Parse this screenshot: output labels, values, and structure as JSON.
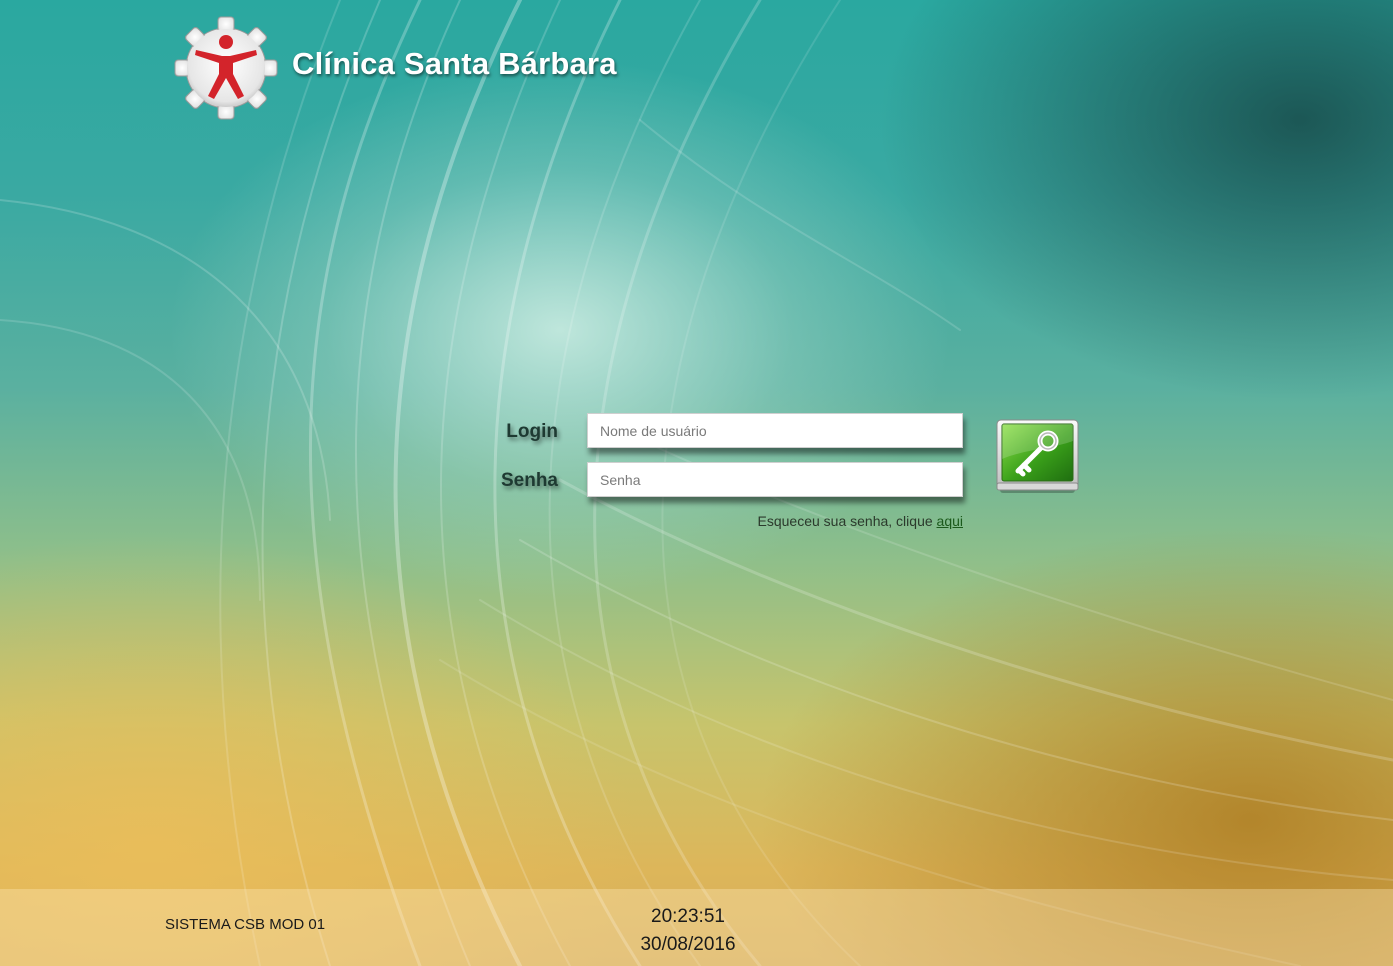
{
  "header": {
    "title": "Clínica Santa Bárbara",
    "logo_icon": "gear-figure-logo-icon"
  },
  "form": {
    "login_label": "Login",
    "password_label": "Senha",
    "username_placeholder": "Nome de usuário",
    "password_placeholder": "Senha",
    "forgot_text": "Esqueceu sua senha, clique ",
    "forgot_link": "aqui",
    "submit_icon": "key-icon"
  },
  "footer": {
    "system_name": "SISTEMA CSB MOD 01",
    "time": "20:23:51",
    "date": "30/08/2016"
  },
  "colors": {
    "accent_green": "#3aa01a",
    "logo_red": "#d3242b"
  }
}
